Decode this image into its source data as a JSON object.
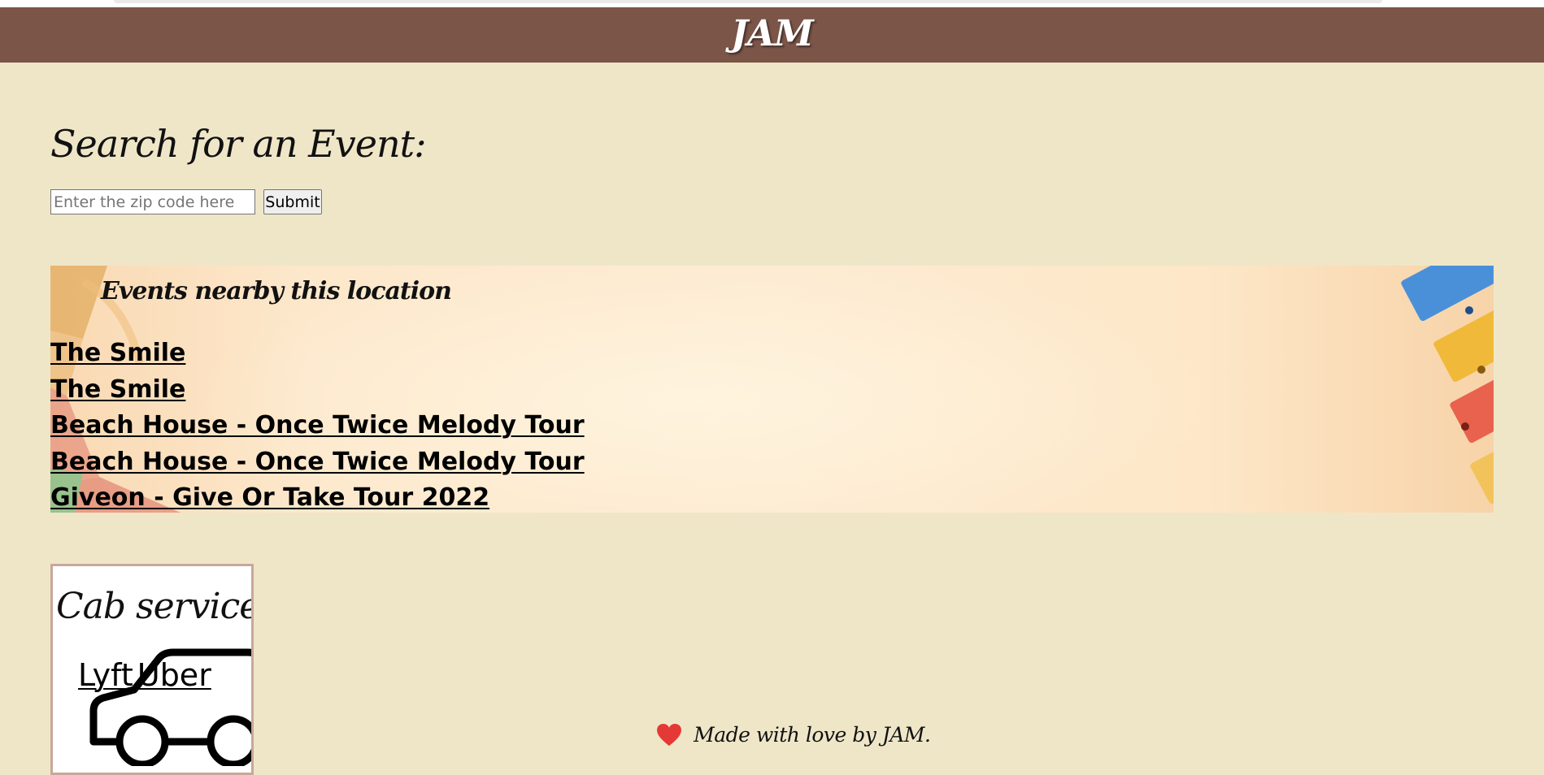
{
  "header": {
    "logo": "JAM",
    "background": "#7a5548"
  },
  "search": {
    "title": "Search for an Event:",
    "input_placeholder": "Enter the zip code here",
    "input_value": "",
    "submit_label": "Submit"
  },
  "events": {
    "title": "Events nearby this location",
    "items": [
      {
        "label": "The Smile"
      },
      {
        "label": "The Smile"
      },
      {
        "label": "Beach House - Once Twice Melody Tour"
      },
      {
        "label": "Beach House - Once Twice Melody Tour"
      },
      {
        "label": "Giveon - Give Or Take Tour 2022"
      }
    ]
  },
  "cab": {
    "title": "Cab services:",
    "links": [
      {
        "label": "Lyft"
      },
      {
        "label": "Uber"
      }
    ],
    "icon": "car-icon"
  },
  "footer": {
    "icon": "heart-icon",
    "text": "Made with love by JAM."
  },
  "colors": {
    "page_background": "#efe6c8",
    "header_background": "#7a5548",
    "heart": "#e53935",
    "card_border": "#c9a79a"
  }
}
